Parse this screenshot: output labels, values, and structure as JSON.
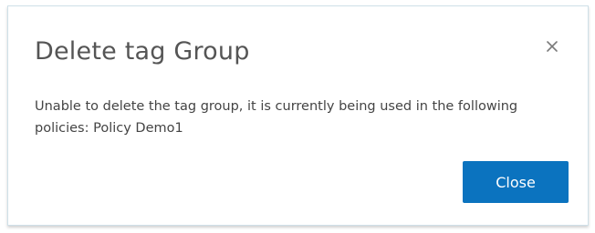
{
  "dialog": {
    "title": "Delete tag Group",
    "message": "Unable to delete the tag group, it is currently being used in the following policies: Policy Demo1",
    "close_button_label": "Close",
    "close_icon": "close-icon"
  },
  "colors": {
    "primary_button": "#0b73bf",
    "title_text": "#555555",
    "body_text": "#444444",
    "dialog_border": "#cfe0e8"
  }
}
